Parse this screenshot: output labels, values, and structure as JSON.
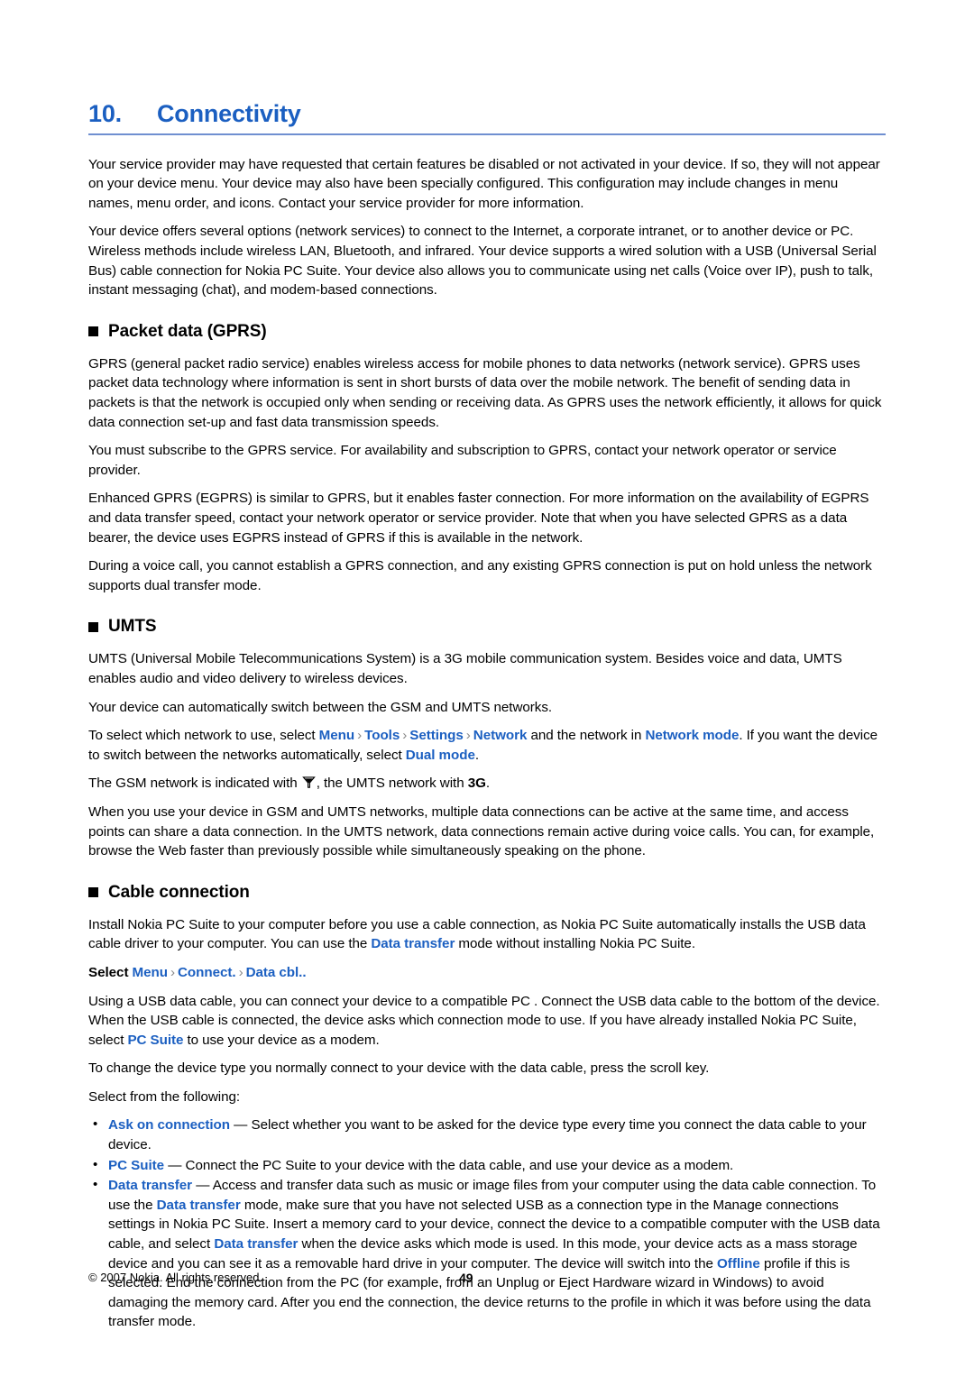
{
  "document": {
    "chapter_number": "10.",
    "chapter_title": "Connectivity",
    "page_number": "49",
    "copyright": "© 2007 Nokia. All rights reserved.",
    "accent_color": "#1b5fc1",
    "rule_color": "#6f8fd0"
  },
  "intro": {
    "para1": "Your service provider may have requested that certain features be disabled or not activated in your device. If so, they will not appear on your device menu. Your device may also have been specially configured. This configuration may include changes in menu names, menu order, and icons. Contact your service provider for more information.",
    "para2": "Your device offers several options (network services) to connect to the Internet, a corporate intranet, or to another device or PC. Wireless methods include wireless LAN, Bluetooth, and infrared. Your device supports a wired solution with a USB (Universal Serial Bus) cable connection for Nokia PC Suite. Your device also allows you to communicate using net calls (Voice over IP), push to talk, instant messaging (chat), and modem-based connections."
  },
  "packet_data": {
    "heading": "Packet data (GPRS)",
    "para1": "GPRS (general packet radio service) enables wireless access for mobile phones to data networks (network service). GPRS uses packet data technology where information is sent in short bursts of data over the mobile network. The benefit of sending data in packets is that the network is occupied only when sending or receiving data. As GPRS uses the network efficiently, it allows for quick data connection set-up and fast data transmission speeds.",
    "para2": "You must subscribe to the GPRS service. For availability and subscription to GPRS, contact your network operator or service provider.",
    "para3": "Enhanced GPRS (EGPRS) is similar to GPRS, but it enables faster connection. For more information on the availability of EGPRS and data transfer speed, contact your network operator or service provider. Note that when you have selected GPRS as a data bearer, the device uses EGPRS instead of GPRS if this is available in the network.",
    "para4": "During a voice call, you cannot establish a GPRS connection, and any existing GPRS connection is put on hold unless the network supports dual transfer mode."
  },
  "umts": {
    "heading": "UMTS",
    "para1": "UMTS (Universal Mobile Telecommunications System) is a 3G mobile communication system. Besides voice and data, UMTS enables audio and video delivery to wireless devices.",
    "para2": "Your device can automatically switch between the GSM and UMTS networks.",
    "select_network": {
      "lead": "To select which network to use, select ",
      "path": [
        "Menu",
        "Tools",
        "Settings",
        "Network"
      ],
      "mid": " and the network in ",
      "network_mode": "Network mode",
      "tail": ". If you want the device to switch between the networks automatically, select ",
      "dual_mode": "Dual mode",
      "end": "."
    },
    "indicator": {
      "lead": "The GSM network is indicated with ",
      "icon": "gsm-signal-icon",
      "mid": ", the UMTS network with ",
      "umts_label": "3G",
      "end": "."
    },
    "para3": "When you use your device in GSM and UMTS networks, multiple data connections can be active at the same time, and access points can share a data connection. In the UMTS network, data connections remain active during voice calls. You can, for example, browse the Web faster than previously possible while simultaneously speaking on the phone."
  },
  "cable": {
    "heading": "Cable connection",
    "para1_a": "Install Nokia PC Suite to your computer before you use a cable connection, as Nokia PC Suite automatically installs the USB data cable driver to your computer. You can use the ",
    "para1_term": "Data transfer",
    "para1_b": " mode without installing Nokia PC Suite.",
    "select_line": {
      "lead": "Select ",
      "path": [
        "Menu",
        "Connect.",
        "Data cbl.."
      ]
    },
    "para2_a": "Using a USB data cable, you can connect your device to a compatible PC . Connect the USB data cable to the bottom of the device. When the USB cable is connected, the device asks which connection mode to use. If you have already installed Nokia PC Suite, select ",
    "para2_term": "PC Suite",
    "para2_b": " to use your device as a modem.",
    "para3": "To change the device type you normally connect to your device with the data cable, press the scroll key.",
    "para4": "Select from the following:",
    "bullets": [
      {
        "term": "Ask on connection",
        "dash": " — ",
        "text": "Select whether you want to be asked for the device type every time you connect the data cable to your device."
      },
      {
        "term": "PC Suite",
        "dash": " — ",
        "text": "Connect the PC Suite to your device with the data cable, and use your device as a modem."
      },
      {
        "term": "Data transfer",
        "dash": " — ",
        "seg1": "Access and transfer data such as music or image files from your computer using the data cable connection. To use the ",
        "term2": "Data transfer",
        "seg2": " mode, make sure that you have not selected USB as a connection type in the Manage connections settings in Nokia PC Suite. Insert a memory card to your device, connect the device to a compatible computer with the USB data cable, and select ",
        "term3": "Data transfer",
        "seg3": " when the device asks which mode is used. In this mode, your device acts as a mass storage device and you can see it as a removable hard drive in your computer. The device will switch into the ",
        "term4": "Offline",
        "seg4": " profile if this is selected. End the connection from the PC (for example, from an Unplug or Eject Hardware wizard in Windows) to avoid damaging the memory card. After you end the connection, the device returns to the profile in which it was before using the data transfer mode."
      }
    ]
  }
}
